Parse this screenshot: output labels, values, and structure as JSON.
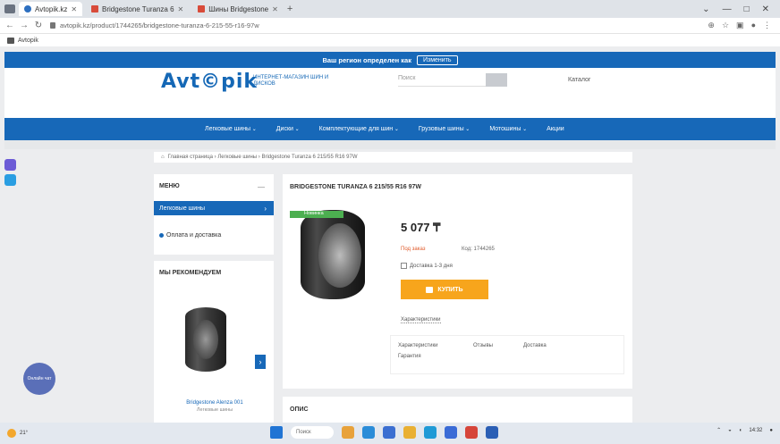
{
  "browser": {
    "tabs": [
      {
        "label": "Avtopik.kz",
        "active": true
      },
      {
        "label": "Bridgestone Turanza 6",
        "active": false
      },
      {
        "label": "Шины Bridgestone",
        "active": false
      }
    ],
    "url": "avtopik.kz/product/1744265/bridgestone-turanza-6-215-55-r16-97w",
    "bookmark": "Avtopik"
  },
  "promo": {
    "text": "Ваш регион определен как",
    "button": "Изменить"
  },
  "header": {
    "logo": "Avt©pik",
    "tagline": "ИНТЕРНЕТ-МАГАЗИН ШИН И ДИСКОВ",
    "search_placeholder": "Поиск",
    "lang": "Каталог"
  },
  "nav": [
    "Легковые шины",
    "Диски",
    "Комплектующие для шин",
    "Грузовые шины",
    "Мотошины",
    "Акции"
  ],
  "breadcrumb": "Главная страница  ›  Легковые шины  ›  Bridgestone Turanza 6 215/55 R16 97W",
  "sidebar": {
    "menu_title": "МЕНЮ",
    "menu_dash": "—",
    "active_item": "Легковые шины",
    "item2": "Оплата и доставка",
    "reco_title": "МЫ РЕКОМЕНДУЕМ",
    "reco_name": "Bridgestone Alenza 001",
    "reco_sub": "Легковые шины"
  },
  "product": {
    "title": "BRIDGESTONE TURANZA 6 215/55 R16 97W",
    "badge": "Новинка",
    "price": "5 077 ₸",
    "availability": "Под заказ",
    "sku": "Код: 1744265",
    "delivery": "Доставка 1-3 дня",
    "buy_label": "КУПИТЬ",
    "more_label": "Характеристики",
    "links": [
      "Характеристики",
      "Отзывы",
      "Доставка",
      "Гарантия"
    ]
  },
  "desc_title": "ОПИС",
  "chat_label": "Онлайн чат",
  "taskbar": {
    "weather": "21°",
    "search": "Поиск",
    "time": "14:32"
  }
}
